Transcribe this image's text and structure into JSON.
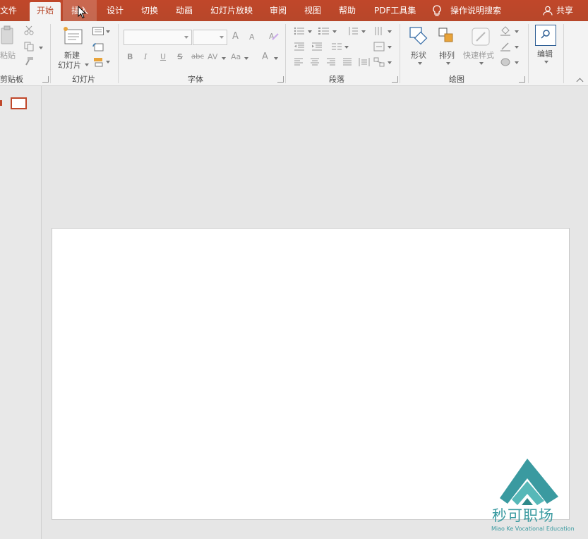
{
  "tabs": [
    {
      "label": "文件"
    },
    {
      "label": "开始"
    },
    {
      "label": "插入"
    },
    {
      "label": "设计"
    },
    {
      "label": "切换"
    },
    {
      "label": "动画"
    },
    {
      "label": "幻灯片放映"
    },
    {
      "label": "审阅"
    },
    {
      "label": "视图"
    },
    {
      "label": "帮助"
    },
    {
      "label": "PDF工具集"
    }
  ],
  "tell_me": "操作说明搜索",
  "share": "共享",
  "ribbon": {
    "clipboard": {
      "paste": "粘贴",
      "label": "剪贴板"
    },
    "slides": {
      "new_slide_line1": "新建",
      "new_slide_line2": "幻灯片",
      "label": "幻灯片"
    },
    "font": {
      "label": "字体",
      "bold": "B",
      "italic": "I",
      "underline": "U",
      "strike": "S",
      "abc": "abc",
      "spacing": "AV",
      "case": "Aa",
      "color": "A",
      "grow": "A",
      "shrink": "A"
    },
    "paragraph": {
      "label": "段落"
    },
    "drawing": {
      "shapes": "形状",
      "arrange": "排列",
      "quick_styles": "快速样式",
      "label": "绘图"
    },
    "editing": {
      "label": "编辑"
    }
  },
  "watermark": {
    "brand": "秒可职场",
    "subtitle": "Miao Ke Vocational Education"
  },
  "colors": {
    "accent": "#b7472a",
    "logo": "#3a9aa0"
  }
}
